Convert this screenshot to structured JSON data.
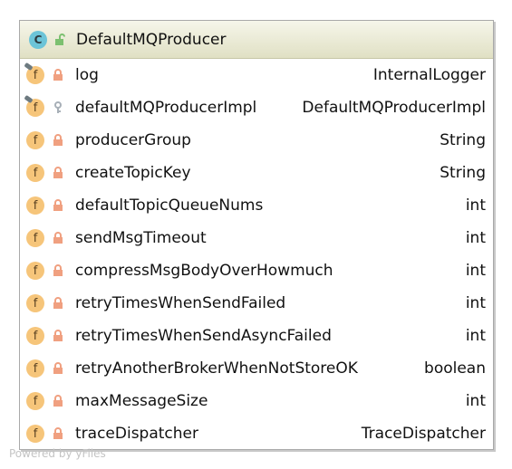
{
  "class": {
    "name": "DefaultMQProducer",
    "kind_icon": "class-icon",
    "visibility_icon": "public-unlock-icon"
  },
  "fields": [
    {
      "name": "log",
      "type": "InternalLogger",
      "access": "private",
      "static": true
    },
    {
      "name": "defaultMQProducerImpl",
      "type": "DefaultMQProducerImpl",
      "access": "package",
      "static": true
    },
    {
      "name": "producerGroup",
      "type": "String",
      "access": "private",
      "static": false
    },
    {
      "name": "createTopicKey",
      "type": "String",
      "access": "private",
      "static": false
    },
    {
      "name": "defaultTopicQueueNums",
      "type": "int",
      "access": "private",
      "static": false
    },
    {
      "name": "sendMsgTimeout",
      "type": "int",
      "access": "private",
      "static": false
    },
    {
      "name": "compressMsgBodyOverHowmuch",
      "type": "int",
      "access": "private",
      "static": false
    },
    {
      "name": "retryTimesWhenSendFailed",
      "type": "int",
      "access": "private",
      "static": false
    },
    {
      "name": "retryTimesWhenSendAsyncFailed",
      "type": "int",
      "access": "private",
      "static": false
    },
    {
      "name": "retryAnotherBrokerWhenNotStoreOK",
      "type": "boolean",
      "access": "private",
      "static": false
    },
    {
      "name": "maxMessageSize",
      "type": "int",
      "access": "private",
      "static": false
    },
    {
      "name": "traceDispatcher",
      "type": "TraceDispatcher",
      "access": "private",
      "static": false
    }
  ],
  "icon_letters": {
    "class": "C",
    "field": "f"
  },
  "colors": {
    "header": "#e6e6cf",
    "field_icon": "#f6c57a",
    "class_icon": "#6cc4d8",
    "private_lock": "#f0a080",
    "package_key": "#a8b0b8",
    "public_lock": "#7cc070"
  },
  "footer": "Powered by yFiles"
}
